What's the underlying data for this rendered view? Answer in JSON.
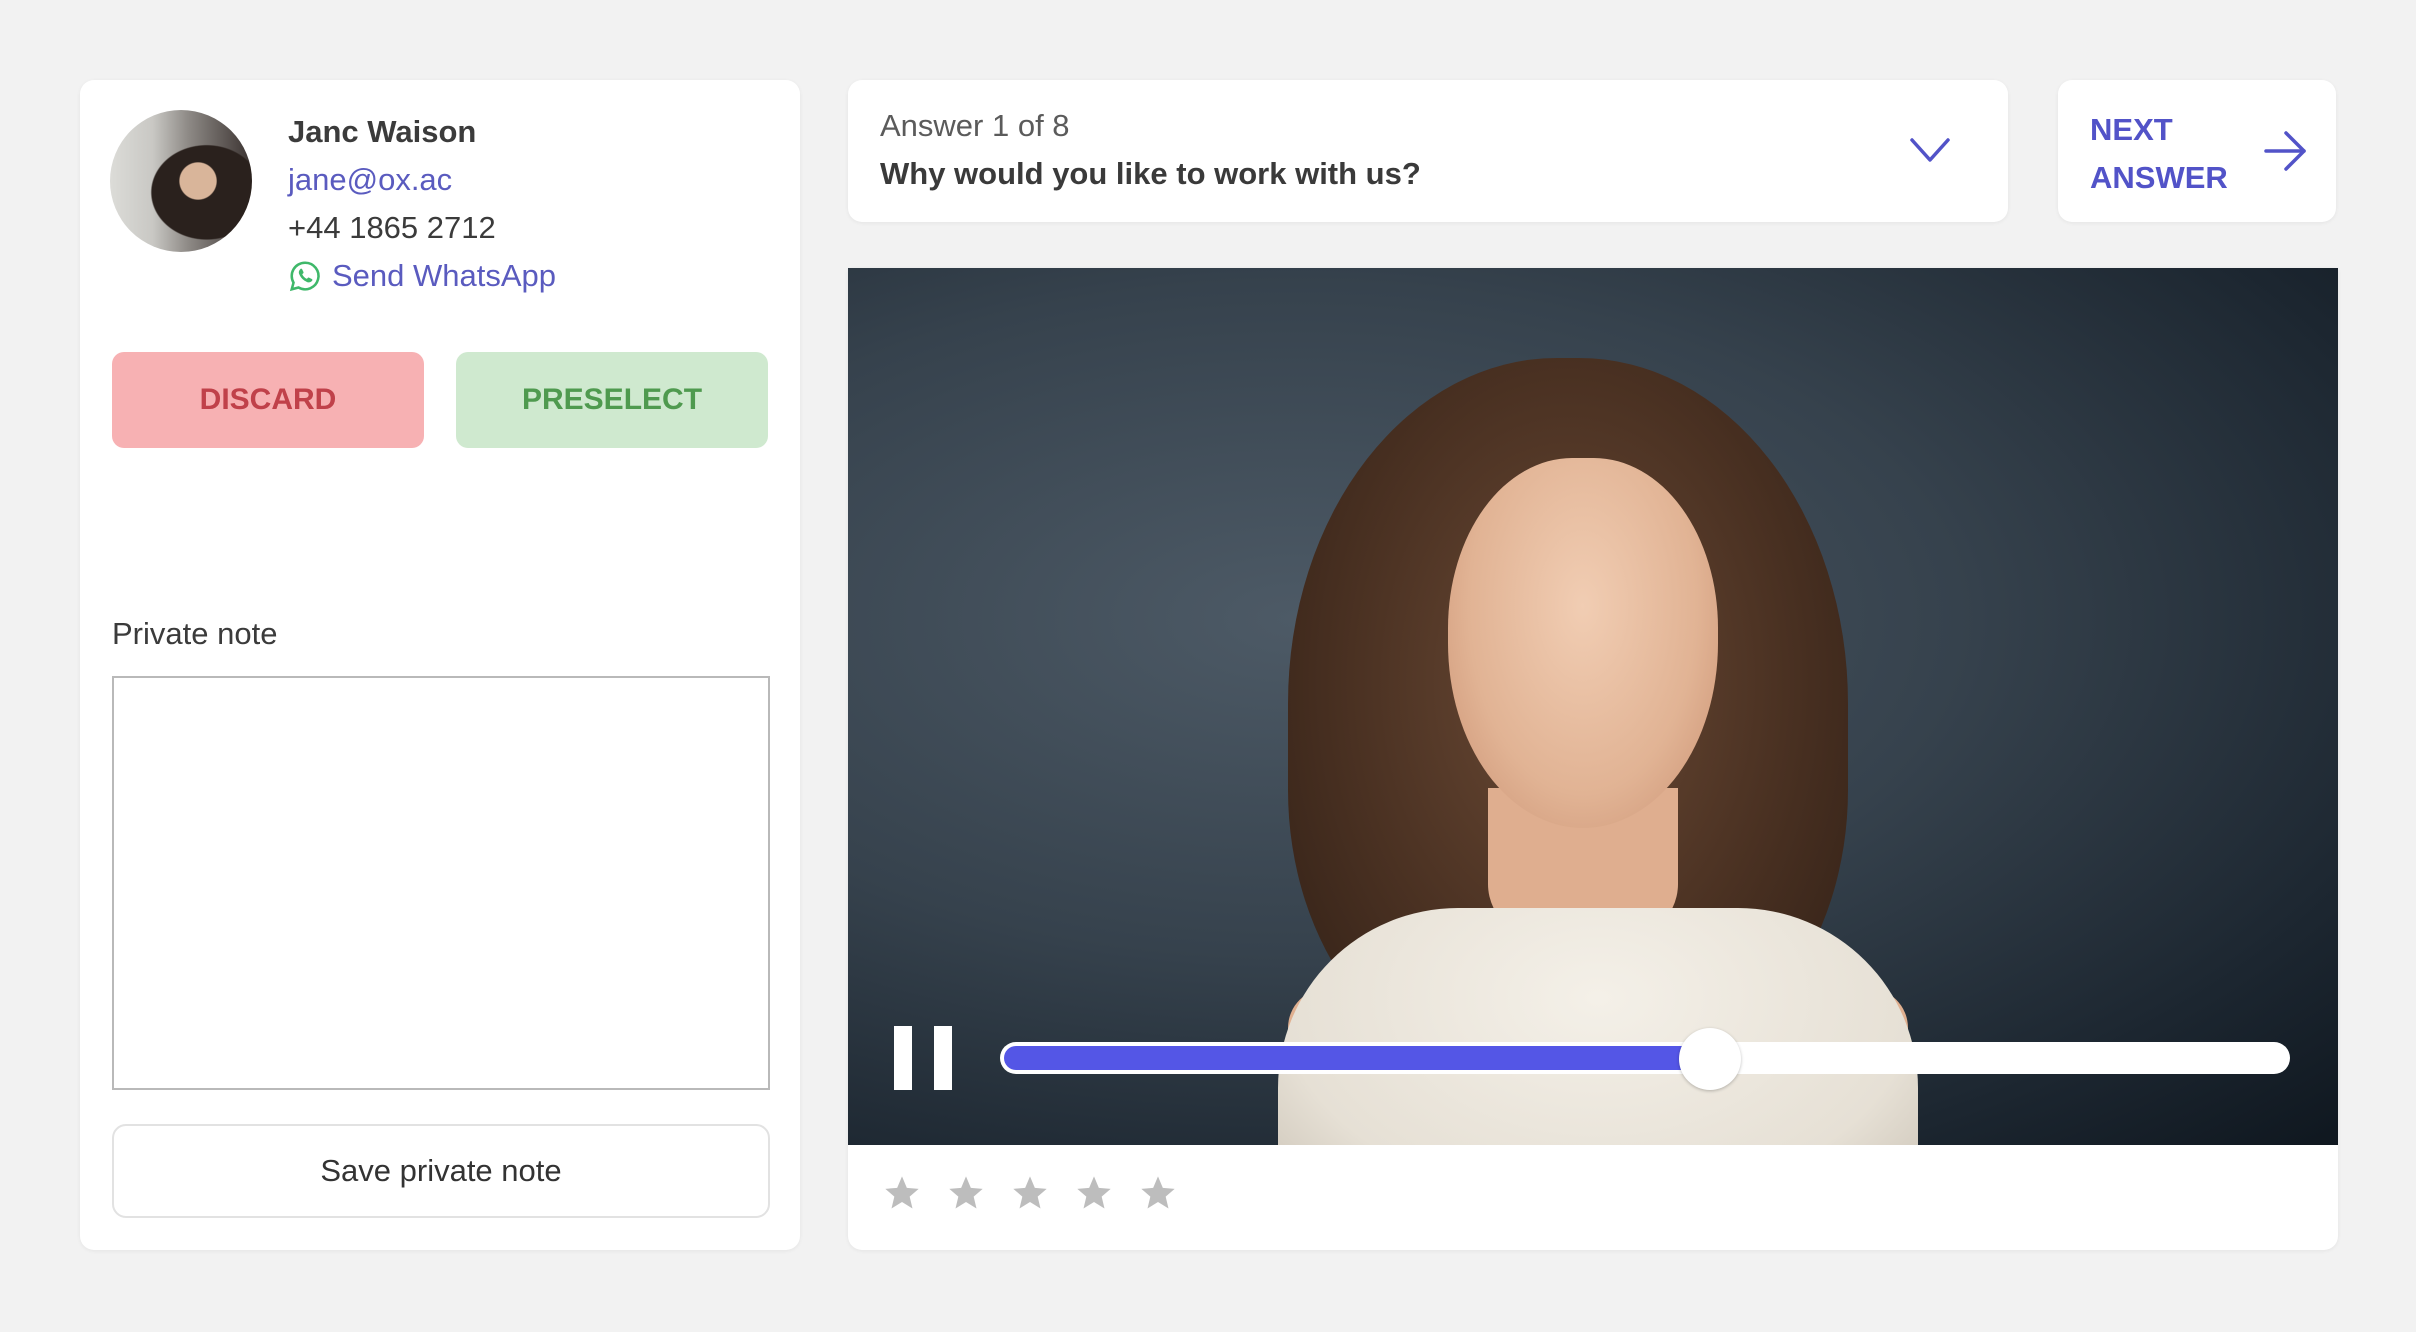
{
  "candidate": {
    "name": "Janc Waison",
    "email": "jane@ox.ac",
    "phone": "+44 1865 2712",
    "whatsapp_label": "Send WhatsApp",
    "avatar_icon": "candidate-photo"
  },
  "actions": {
    "discard_label": "DISCARD",
    "preselect_label": "PRESELECT"
  },
  "note": {
    "label": "Private note",
    "value": "",
    "placeholder": "",
    "save_label": "Save private note"
  },
  "question": {
    "counter": "Answer 1 of 8",
    "title": "Why would you like to work with us?",
    "dropdown_icon": "chevron-down-icon"
  },
  "next": {
    "line1": "NEXT",
    "line2": "ANSWER",
    "icon": "arrow-right-icon"
  },
  "player": {
    "state": "playing",
    "progress": 0.55,
    "control_icon": "pause-icon"
  },
  "rating": {
    "max": 5,
    "value": 0
  },
  "colors": {
    "accent": "#5456e6",
    "link": "#5a5bbf",
    "discard_bg": "#f7b1b3",
    "discard_text": "#c0414a",
    "preselect_bg": "#cfe9cf",
    "preselect_text": "#4f9a4f",
    "whatsapp": "#3fb86a",
    "star_empty": "#bdbdbd"
  }
}
